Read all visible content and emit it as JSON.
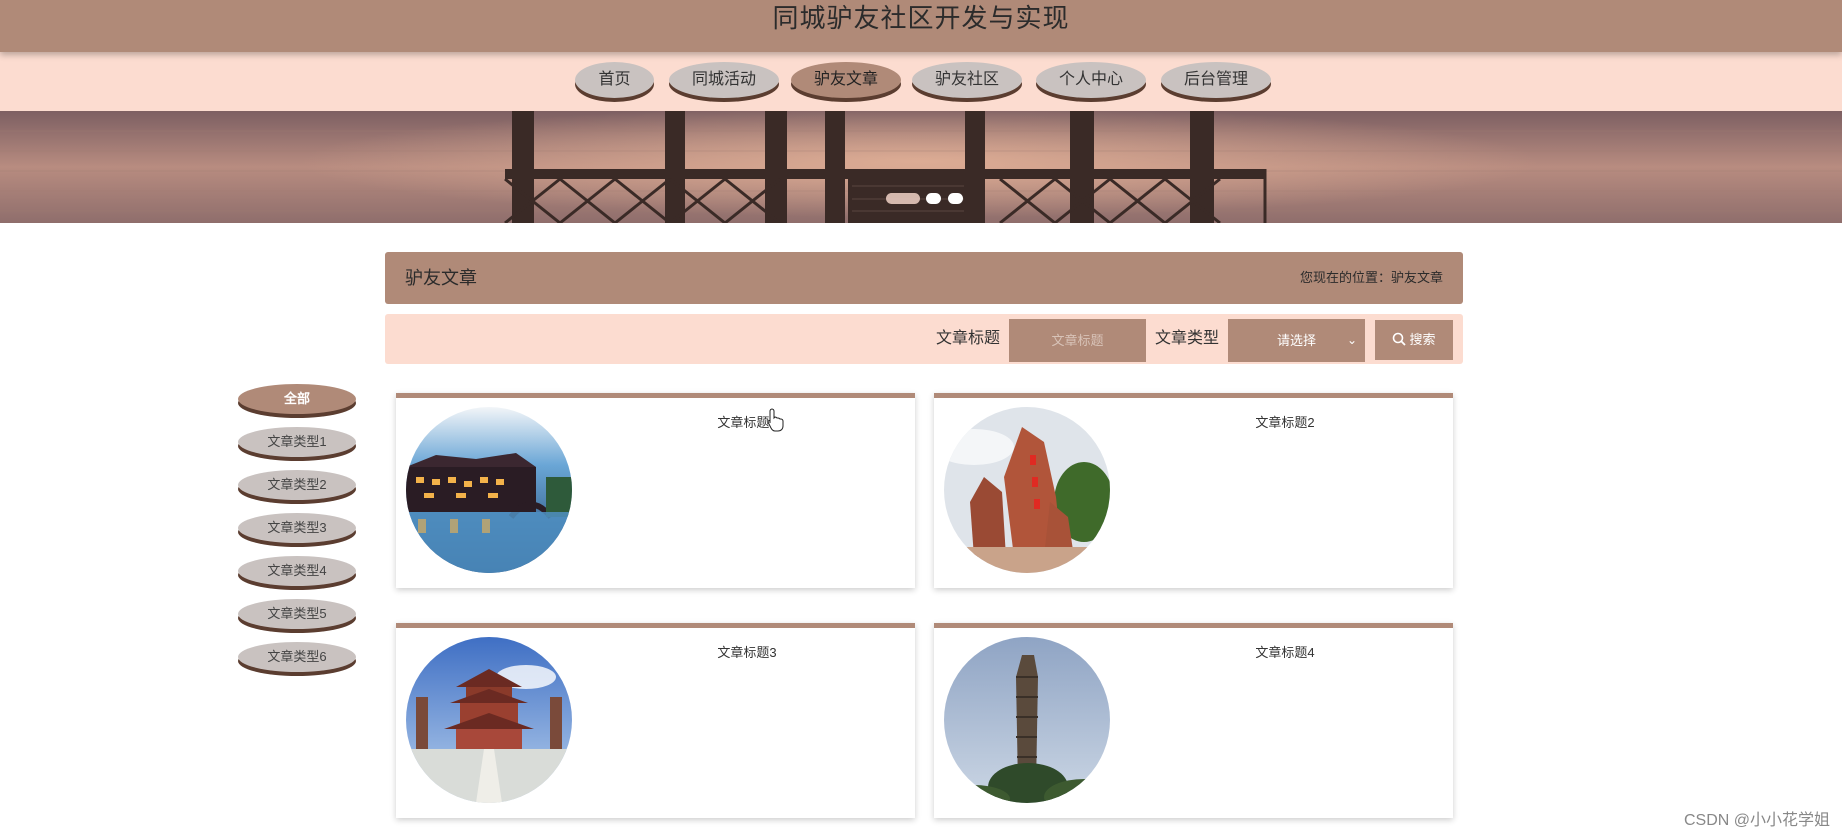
{
  "site": {
    "title": "同城驴友社区开发与实现"
  },
  "nav": {
    "items": [
      {
        "label": "首页"
      },
      {
        "label": "同城活动"
      },
      {
        "label": "驴友文章"
      },
      {
        "label": "驴友社区"
      },
      {
        "label": "个人中心"
      },
      {
        "label": "后台管理"
      }
    ],
    "active": "驴友文章"
  },
  "banner": {
    "slide_count": 3,
    "active_slide": 1
  },
  "page": {
    "title": "驴友文章",
    "location": "您现在的位置：驴友文章"
  },
  "search": {
    "title_label": "文章标题",
    "title_placeholder": "文章标题",
    "type_label": "文章类型",
    "type_selected": "请选择",
    "button_label": "搜索"
  },
  "categories": {
    "items": [
      {
        "label": "全部"
      },
      {
        "label": "文章类型1"
      },
      {
        "label": "文章类型2"
      },
      {
        "label": "文章类型3"
      },
      {
        "label": "文章类型4"
      },
      {
        "label": "文章类型5"
      },
      {
        "label": "文章类型6"
      }
    ],
    "active": "全部"
  },
  "articles": [
    {
      "title": "文章标题1",
      "image": "water-town-night"
    },
    {
      "title": "文章标题2",
      "image": "red-rock-monument"
    },
    {
      "title": "文章标题3",
      "image": "temple-pagoda"
    },
    {
      "title": "文章标题4",
      "image": "stone-tower"
    }
  ],
  "watermark": "CSDN @小小花学姐",
  "colors": {
    "header": "#b08a78",
    "nav_bg": "#fcdcd0",
    "pill": "#c9c2c0",
    "pill_shadow": "#5b3d30"
  }
}
